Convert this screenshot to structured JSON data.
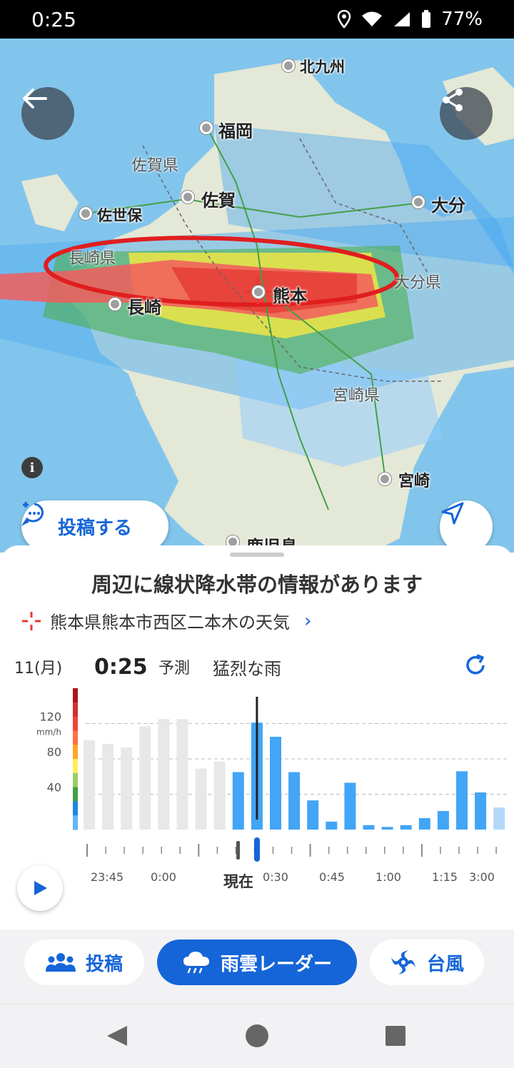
{
  "status_bar": {
    "time": "0:25",
    "battery": "77%",
    "icons": [
      "location-icon",
      "wifi-icon",
      "signal-icon",
      "battery-icon"
    ]
  },
  "map": {
    "cities": [
      {
        "name": "北九州"
      },
      {
        "name": "福岡"
      },
      {
        "name": "佐賀"
      },
      {
        "name": "佐世保"
      },
      {
        "name": "大分"
      },
      {
        "name": "長崎"
      },
      {
        "name": "熊本"
      },
      {
        "name": "宮崎"
      },
      {
        "name": "鹿児島"
      }
    ],
    "prefectures": [
      "佐賀県",
      "長崎県",
      "大分県",
      "宮崎県"
    ],
    "buttons": {
      "back": "back-arrow-icon",
      "share": "share-icon",
      "info": "i",
      "post": "投稿する",
      "locate": "navigation-arrow-icon"
    },
    "highlight_color": "#e01e1e"
  },
  "sheet": {
    "title": "周辺に線状降水帯の情報があります",
    "location": "熊本県熊本市西区二本木の天気",
    "date": "11(月)",
    "time": "0:25",
    "forecast_label": "予測",
    "condition": "猛烈な雨"
  },
  "chart_data": {
    "type": "bar",
    "ylabel": "mm/h",
    "ylim": [
      0,
      160
    ],
    "y_ticks": [
      "40",
      "80",
      "120"
    ],
    "x_tick_labels": [
      "23:45",
      "0:00",
      "現在",
      "0:30",
      "0:45",
      "1:00",
      "1:15",
      "3:00"
    ],
    "series": [
      {
        "name": "past",
        "color": "#e8e8e8",
        "values": [
          101,
          97,
          93,
          117,
          125,
          125,
          69,
          77
        ]
      },
      {
        "name": "forecast",
        "color": "#42a5f5",
        "values": [
          65,
          121,
          105,
          65,
          33,
          9,
          53,
          5,
          3,
          5,
          13,
          21,
          66,
          42,
          25
        ]
      }
    ],
    "current_index": 9,
    "colorscale": [
      "#a81818",
      "#d32f2f",
      "#f44336",
      "#ff7043",
      "#ffa726",
      "#ffee58",
      "#9ccc65",
      "#43a047",
      "#1e88e5",
      "#64b5f6"
    ]
  },
  "tabs": [
    {
      "label": "投稿",
      "icon": "people-icon",
      "active": false
    },
    {
      "label": "雨雲レーダー",
      "icon": "rain-cloud-icon",
      "active": true
    },
    {
      "label": "台風",
      "icon": "typhoon-icon",
      "active": false
    }
  ],
  "colors": {
    "accent": "#1565d8",
    "forecast_bar": "#42a5f5",
    "past_bar": "#e8e8e8"
  }
}
